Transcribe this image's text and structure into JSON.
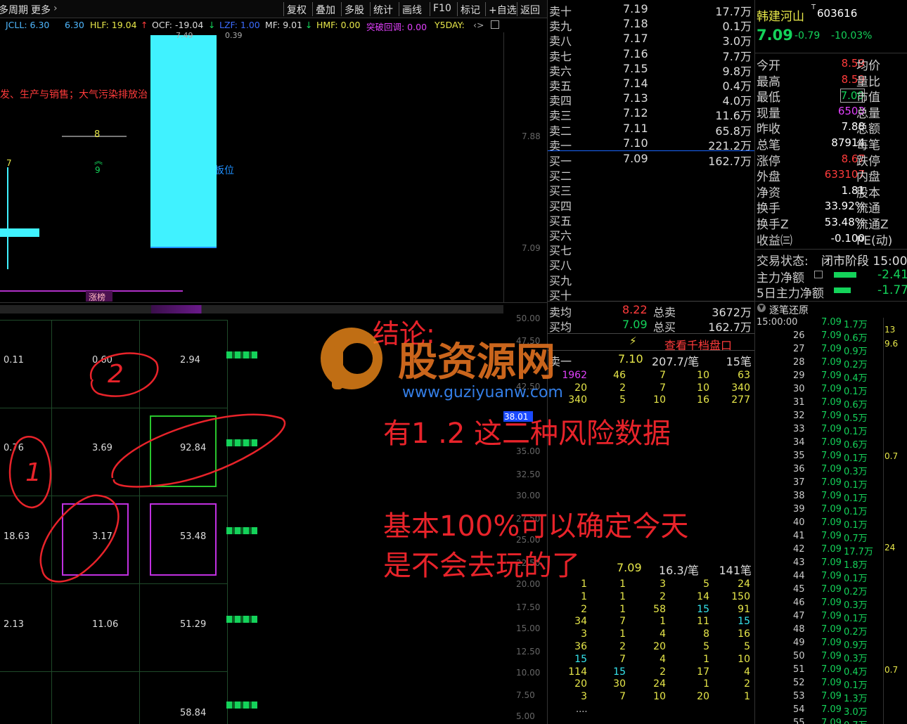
{
  "toolbar": {
    "period_label": "多周期",
    "more_label": "更多",
    "buttons": [
      "复权",
      "叠加",
      "多股",
      "统计",
      "画线",
      "F10",
      "标记",
      "+自选",
      "返回"
    ]
  },
  "indicators": {
    "jcll": "JCLL: 6.30",
    "jcll2": "6.30",
    "hlf": "HLF: 19.04",
    "ocf": "OCF: -19.04",
    "lzf": "LZF: 1.00",
    "mf": "MF: 9.01",
    "hmf": "HMF: 0.00",
    "breakback": "突破回调: 0.00",
    "y5day": "Y5DAY:"
  },
  "chart": {
    "sector_text": "发、生产与销售；大气污染排放治",
    "limit_text": "板位",
    "top_value": "7.88",
    "mid_value": "7.09",
    "zhangbang": "涨榜",
    "label_7": "7",
    "label_8": "8",
    "label_9": "9",
    "label_top": "7.49",
    "label_top2": "0.39"
  },
  "lower_axis": [
    "50.00",
    "47.50",
    "42.50",
    "38.01",
    "35.00",
    "32.50",
    "30.00",
    "27.50",
    "25.00",
    "22.50",
    "20.00",
    "17.50",
    "15.00",
    "12.50",
    "10.00",
    "7.50",
    "5.00"
  ],
  "grid_values": [
    [
      "0.11",
      "0.60",
      "2.94"
    ],
    [
      "0.76",
      "3.69",
      "92.84"
    ],
    [
      "18.63",
      "3.17",
      "53.48"
    ],
    [
      "2.13",
      "11.06",
      "51.29"
    ],
    [
      "",
      "",
      "58.84"
    ]
  ],
  "orderbook": {
    "asks": [
      {
        "label": "卖十",
        "price": "7.19",
        "vol": "17.7万"
      },
      {
        "label": "卖九",
        "price": "7.18",
        "vol": "0.1万"
      },
      {
        "label": "卖八",
        "price": "7.17",
        "vol": "3.0万"
      },
      {
        "label": "卖七",
        "price": "7.16",
        "vol": "7.7万"
      },
      {
        "label": "卖六",
        "price": "7.15",
        "vol": "9.8万"
      },
      {
        "label": "卖五",
        "price": "7.14",
        "vol": "0.4万"
      },
      {
        "label": "卖四",
        "price": "7.13",
        "vol": "4.0万"
      },
      {
        "label": "卖三",
        "price": "7.12",
        "vol": "11.6万"
      },
      {
        "label": "卖二",
        "price": "7.11",
        "vol": "65.8万"
      },
      {
        "label": "卖一",
        "price": "7.10",
        "vol": "221.2万"
      }
    ],
    "bids": [
      {
        "label": "买一",
        "price": "7.09",
        "vol": "162.7万"
      },
      {
        "label": "买二",
        "price": "",
        "vol": ""
      },
      {
        "label": "买三",
        "price": "",
        "vol": ""
      },
      {
        "label": "买四",
        "price": "",
        "vol": ""
      },
      {
        "label": "买五",
        "price": "",
        "vol": ""
      },
      {
        "label": "买六",
        "price": "",
        "vol": ""
      },
      {
        "label": "买七",
        "price": "",
        "vol": ""
      },
      {
        "label": "买八",
        "price": "",
        "vol": ""
      },
      {
        "label": "买九",
        "price": "",
        "vol": ""
      },
      {
        "label": "买十",
        "price": "",
        "vol": ""
      }
    ],
    "avg_ask_label": "卖均",
    "avg_ask": "8.22",
    "total_ask_label": "总卖",
    "total_ask": "3672万",
    "avg_bid_label": "买均",
    "avg_bid": "7.09",
    "total_bid_label": "总买",
    "total_bid": "162.7万",
    "view_depth": "查看千档盘口",
    "sell1_summary": {
      "label": "卖一",
      "price": "7.10",
      "amt": "207.7/笔",
      "count": "15笔"
    },
    "sell1_queue": [
      [
        "1962",
        "46",
        "7",
        "10",
        "63"
      ],
      [
        "20",
        "2",
        "7",
        "10",
        "340"
      ],
      [
        "340",
        "5",
        "10",
        "16",
        "277"
      ]
    ],
    "buy1_summary": {
      "price": "7.09",
      "amt": "16.3/笔",
      "count": "141笔"
    },
    "buy1_queue": [
      [
        "1",
        "1",
        "3",
        "5",
        "24"
      ],
      [
        "1",
        "1",
        "2",
        "14",
        "150"
      ],
      [
        "2",
        "1",
        "58",
        "15",
        "91"
      ],
      [
        "34",
        "7",
        "1",
        "11",
        "15"
      ],
      [
        "3",
        "1",
        "4",
        "8",
        "16"
      ],
      [
        "36",
        "2",
        "20",
        "5",
        "5"
      ],
      [
        "15",
        "7",
        "4",
        "1",
        "10"
      ],
      [
        "114",
        "15",
        "2",
        "17",
        "4"
      ],
      [
        "20",
        "30",
        "24",
        "1",
        "2"
      ],
      [
        "3",
        "7",
        "10",
        "20",
        "1"
      ]
    ],
    "more": "...."
  },
  "stock": {
    "name": "韩建河山",
    "code": "603616",
    "price": "7.09",
    "change": "-0.79",
    "pct": "-10.03%"
  },
  "quote_rows": [
    {
      "k": "今开",
      "v": "8.59",
      "k2": "均价",
      "color": "red"
    },
    {
      "k": "最高",
      "v": "8.59",
      "k2": "量比",
      "color": "red"
    },
    {
      "k": "最低",
      "v": "7.09",
      "k2": "市值",
      "color": "green"
    },
    {
      "k": "现量",
      "v": "6503",
      "k2": "总量",
      "color": "magenta"
    },
    {
      "k": "昨收",
      "v": "7.88",
      "k2": "总额",
      "color": "white"
    },
    {
      "k": "总笔",
      "v": "87914",
      "k2": "每笔",
      "color": "white"
    },
    {
      "k": "涨停",
      "v": "8.67",
      "k2": "跌停",
      "color": "red"
    },
    {
      "k": "外盘",
      "v": "633107",
      "k2": "内盘",
      "color": "red"
    },
    {
      "k": "净资",
      "v": "1.81",
      "k2": "股本",
      "color": "white"
    },
    {
      "k": "换手",
      "v": "33.92%",
      "k2": "流通",
      "color": "white"
    },
    {
      "k": "换手Z",
      "v": "53.48%",
      "k2": "流通Z",
      "color": "white"
    },
    {
      "k": "收益㈢",
      "v": "-0.100",
      "k2": "PE(动)",
      "color": "white"
    }
  ],
  "trade_status": {
    "label": "交易状态:",
    "value": "闭市阶段 15:00:"
  },
  "main_flow": {
    "label": "主力净额",
    "value": "-2.41"
  },
  "main_flow5": {
    "label": "5日主力净额",
    "value": "-1.77"
  },
  "tick_header": "逐笔还原",
  "ticks": [
    {
      "t": "15:00:00",
      "p": "7.09",
      "v": "1.7万"
    },
    {
      "t": "26",
      "p": "7.09",
      "v": "0.6万"
    },
    {
      "t": "27",
      "p": "7.09",
      "v": "0.9万"
    },
    {
      "t": "28",
      "p": "7.09",
      "v": "0.2万"
    },
    {
      "t": "29",
      "p": "7.09",
      "v": "0.4万"
    },
    {
      "t": "30",
      "p": "7.09",
      "v": "0.1万"
    },
    {
      "t": "31",
      "p": "7.09",
      "v": "0.6万"
    },
    {
      "t": "32",
      "p": "7.09",
      "v": "0.5万"
    },
    {
      "t": "33",
      "p": "7.09",
      "v": "0.1万"
    },
    {
      "t": "34",
      "p": "7.09",
      "v": "0.6万"
    },
    {
      "t": "35",
      "p": "7.09",
      "v": "0.1万"
    },
    {
      "t": "36",
      "p": "7.09",
      "v": "0.3万"
    },
    {
      "t": "37",
      "p": "7.09",
      "v": "0.1万"
    },
    {
      "t": "38",
      "p": "7.09",
      "v": "0.1万"
    },
    {
      "t": "39",
      "p": "7.09",
      "v": "0.1万"
    },
    {
      "t": "40",
      "p": "7.09",
      "v": "0.1万"
    },
    {
      "t": "41",
      "p": "7.09",
      "v": "0.7万"
    },
    {
      "t": "42",
      "p": "7.09",
      "v": "17.7万"
    },
    {
      "t": "43",
      "p": "7.09",
      "v": "1.8万"
    },
    {
      "t": "44",
      "p": "7.09",
      "v": "0.1万"
    },
    {
      "t": "45",
      "p": "7.09",
      "v": "0.2万"
    },
    {
      "t": "46",
      "p": "7.09",
      "v": "0.3万"
    },
    {
      "t": "47",
      "p": "7.09",
      "v": "0.1万"
    },
    {
      "t": "48",
      "p": "7.09",
      "v": "0.2万"
    },
    {
      "t": "49",
      "p": "7.09",
      "v": "0.9万"
    },
    {
      "t": "50",
      "p": "7.09",
      "v": "0.3万"
    },
    {
      "t": "51",
      "p": "7.09",
      "v": "0.4万"
    },
    {
      "t": "52",
      "p": "7.09",
      "v": "0.1万"
    },
    {
      "t": "53",
      "p": "7.09",
      "v": "1.3万"
    },
    {
      "t": "54",
      "p": "7.09",
      "v": "3.0万"
    },
    {
      "t": "55",
      "p": "7.09",
      "v": "0.7万"
    }
  ],
  "side_values": [
    "13",
    "9.6",
    "0.7",
    "24",
    "0.7"
  ],
  "annotations": {
    "conclusion": "结论:",
    "risk": "有1  .2  这二种风险数据",
    "line1": "基本100%可以确定今天",
    "line2": "是不会去玩的了",
    "mark1": "1",
    "mark2": "2"
  },
  "watermark": {
    "brand": "股资源网",
    "url": "www.guziyuanw.com"
  }
}
